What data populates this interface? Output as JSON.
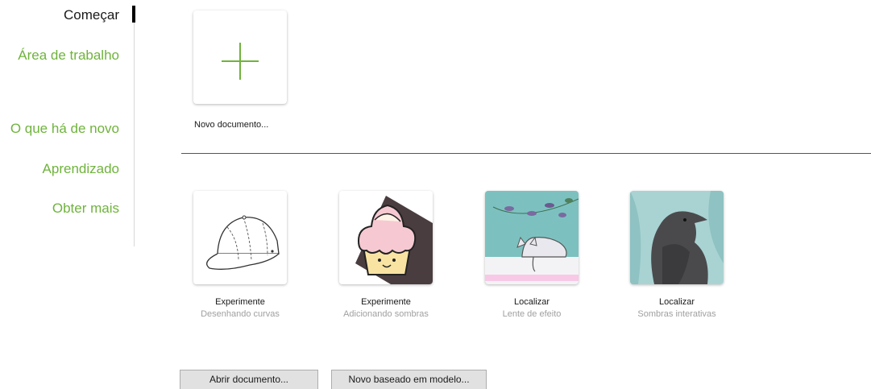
{
  "sidebar": {
    "items": [
      {
        "label": "Começar"
      },
      {
        "label": "Área de trabalho"
      },
      {
        "label": "O que há de novo"
      },
      {
        "label": "Aprendizado"
      },
      {
        "label": "Obter mais"
      }
    ]
  },
  "new_document": {
    "label": "Novo documento...",
    "icon": "plus-icon"
  },
  "cards": [
    {
      "title": "Experimente",
      "subtitle": "Desenhando curvas",
      "image": "cap-thumbnail"
    },
    {
      "title": "Experimente",
      "subtitle": "Adicionando sombras",
      "image": "cupcake-thumbnail"
    },
    {
      "title": "Localizar",
      "subtitle": "Lente de efeito",
      "image": "cat-thumbnail"
    },
    {
      "title": "Localizar",
      "subtitle": "Sombras interativas",
      "image": "raven-thumbnail"
    }
  ],
  "buttons": {
    "open_document": "Abrir documento...",
    "new_from_template": "Novo baseado em modelo..."
  },
  "colors": {
    "accent": "#6fb33c",
    "text": "#1a1a1a",
    "muted": "#a0a0a0"
  }
}
